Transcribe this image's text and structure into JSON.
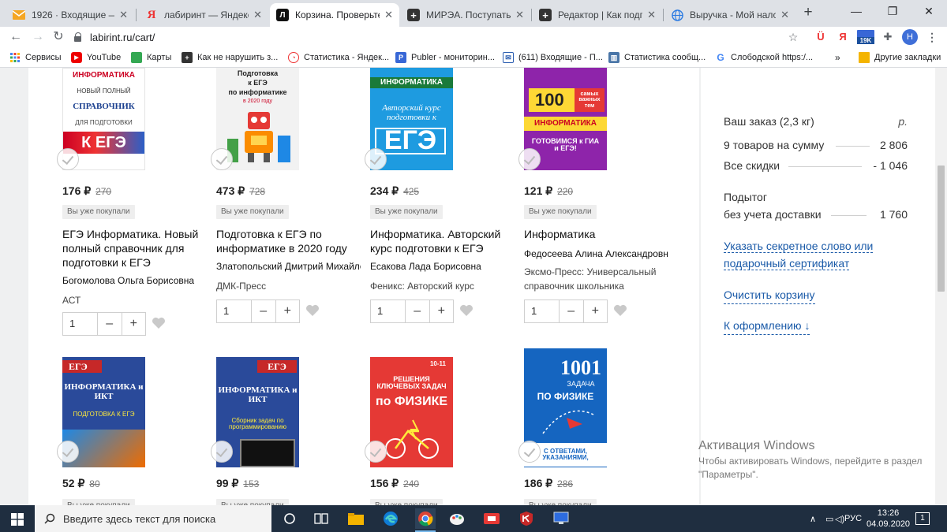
{
  "browser": {
    "tabs": [
      {
        "title": "1926 · Входящие — Ян",
        "favicon": "mail-icon",
        "color": "#f5a623"
      },
      {
        "title": "лабиринт — Яндекс: н",
        "favicon": "yandex-icon",
        "color": "#e33"
      },
      {
        "title": "Корзина. Проверьте за",
        "favicon": "labirint-icon",
        "color": "#222"
      },
      {
        "title": "МИРЭА. Поступать или",
        "favicon": "plus-icon",
        "color": "#333"
      },
      {
        "title": "Редактор | Как подгото",
        "favicon": "plus-icon",
        "color": "#333"
      },
      {
        "title": "Выручка - Мой налог",
        "favicon": "globe-icon",
        "color": "#2a7ae2"
      }
    ],
    "url": "labirint.ru/cart/",
    "badge": "19K",
    "profile_initial": "Н",
    "bookmarks": [
      {
        "label": "Сервисы",
        "icon": "apps-grid-icon",
        "color": "#4285f4"
      },
      {
        "label": "YouTube",
        "icon": "youtube-icon",
        "color": "#e00"
      },
      {
        "label": "Карты",
        "icon": "maps-icon",
        "color": "#34a853"
      },
      {
        "label": "Как не нарушить з...",
        "icon": "plus-icon",
        "color": "#333"
      },
      {
        "label": "Статистика - Яндек...",
        "icon": "chart-icon",
        "color": "#e33"
      },
      {
        "label": "Publer - мониторин...",
        "icon": "publer-icon",
        "color": "#3867d6"
      },
      {
        "label": "(611) Входящие - П...",
        "icon": "mail-icon",
        "color": "#2a5db0"
      },
      {
        "label": "Статистика сообщ...",
        "icon": "stats-icon",
        "color": "#4a76a8"
      },
      {
        "label": "Слободской https:/...",
        "icon": "google-icon",
        "color": "#4285f4"
      }
    ],
    "more_bookmarks": "»",
    "other_bookmarks": "Другие закладки"
  },
  "cart": {
    "bought_label": "Вы уже покупали",
    "currency": "₽",
    "items": [
      {
        "cover_lines": [
          "ИНФОРМАТИКА",
          "НОВЫЙ ПОЛНЫЙ",
          "СПРАВОЧНИК",
          "ДЛЯ ПОДГОТОВКИ",
          "К ЕГЭ"
        ],
        "price": "176",
        "old_price": "270",
        "title": "ЕГЭ Информатика. Новый полный справочник для подготовки к ЕГЭ",
        "author": "Богомолова Ольга Борисовна",
        "publisher": "АСТ",
        "qty": "1"
      },
      {
        "cover_lines": [
          "Подготовка",
          "к ЕГЭ",
          "по информатике",
          "в 2020 году"
        ],
        "price": "473",
        "old_price": "728",
        "title": "Подготовка к ЕГЭ по информатике в 2020 году",
        "author": "Златопольский Дмитрий Михайлович",
        "publisher": "ДМК-Пресс",
        "qty": "1"
      },
      {
        "cover_lines": [
          "ИНФОРМАТИКА",
          "Авторский курс подготовки к",
          "ЕГЭ"
        ],
        "price": "234",
        "old_price": "425",
        "title": "Информатика. Авторский курс подготовки к ЕГЭ",
        "author": "Есакова Лада Борисовна",
        "publisher": "Феникс: Авторский курс",
        "qty": "1"
      },
      {
        "cover_lines": [
          "100",
          "самых важных тем",
          "ИНФОРМАТИКА",
          "ГОТОВИМСЯ к ГИА и ЕГЭ!"
        ],
        "price": "121",
        "old_price": "220",
        "title": "Информатика",
        "author": "Федосеева Алина Александровна",
        "publisher": "Эксмо-Пресс: Универсальный справочник школьника",
        "qty": "1"
      },
      {
        "cover_lines": [
          "ЕГЭ",
          "ИНФОРМАТИКА и ИКТ",
          "ПОДГОТОВКА К ЕГЭ"
        ],
        "price": "52",
        "old_price": "80",
        "bought_label": "Вы уже покупали"
      },
      {
        "cover_lines": [
          "ЕГЭ",
          "ИНФОРМАТИКА и ИКТ",
          "Сборник задач по программированию"
        ],
        "price": "99",
        "old_price": "153",
        "bought_label": "Вы уже покупали"
      },
      {
        "cover_lines": [
          "10-11",
          "РЕШЕНИЯ КЛЮЧЕВЫХ ЗАДАЧ",
          "по ФИЗИКЕ"
        ],
        "price": "156",
        "old_price": "240",
        "bought_label": "Вы уже покупали"
      },
      {
        "cover_lines": [
          "1001",
          "ЗАДАЧА",
          "ПО ФИЗИКЕ",
          "С ОТВЕТАМИ, УКАЗАНИЯМИ,"
        ],
        "price": "186",
        "old_price": "286",
        "bought_label": "Вы уже покупали"
      }
    ]
  },
  "summary": {
    "order_label": "Ваш заказ (2,3 кг)",
    "currency_label": "р.",
    "goods_label": "9 товаров на сумму",
    "goods_value": "2 806",
    "discount_label": "Все скидки",
    "discount_value": "- 1 046",
    "subtotal_label_1": "Подытог",
    "subtotal_label_2": "без учета доставки",
    "subtotal_value": "1 760",
    "secret_link": "Указать секретное слово или подарочный сертификат",
    "clear_link": "Очистить корзину",
    "checkout_link": "К оформлению ↓"
  },
  "activation": {
    "title": "Активация Windows",
    "subtitle": "Чтобы активировать Windows, перейдите в раздел \"Параметры\"."
  },
  "taskbar": {
    "search_placeholder": "Введите здесь текст для поиска",
    "language": "РУС",
    "time": "13:26",
    "date": "04.09.2020",
    "notification_count": "1"
  }
}
